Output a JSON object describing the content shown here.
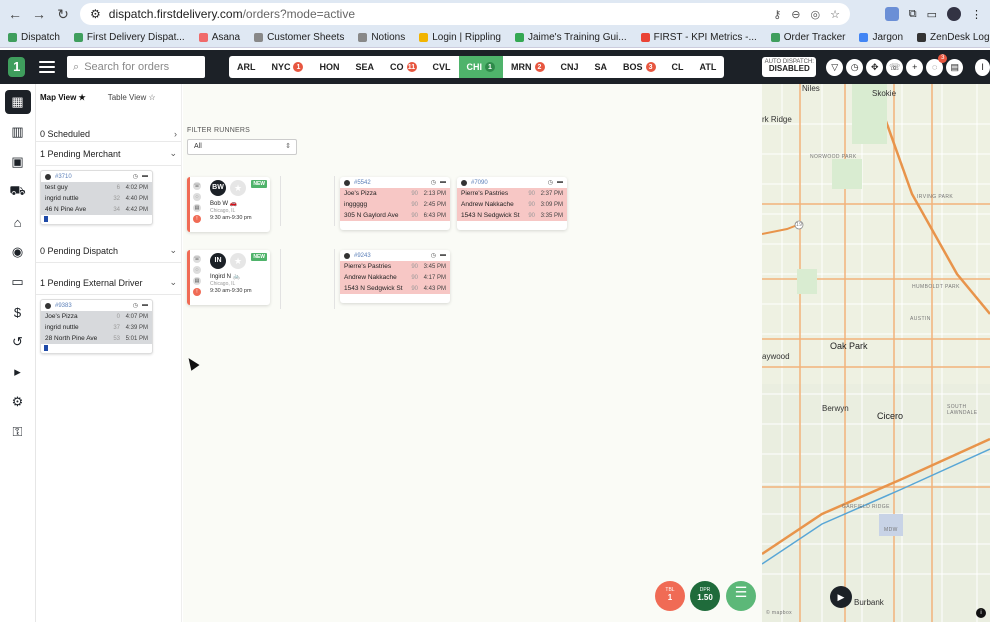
{
  "browser": {
    "url_host": "dispatch.firstdelivery.com",
    "url_path": "/orders?mode=active",
    "bookmarks": [
      {
        "label": "Dispatch",
        "color": "#3f9e5d"
      },
      {
        "label": "First Delivery Dispat...",
        "color": "#3f9e5d"
      },
      {
        "label": "Asana",
        "color": "#f06a6a"
      },
      {
        "label": "Customer Sheets",
        "color": "#888888"
      },
      {
        "label": "Notions",
        "color": "#888888"
      },
      {
        "label": "Login | Rippling",
        "color": "#f2b400"
      },
      {
        "label": "Jaime's Training Gui...",
        "color": "#34a853"
      },
      {
        "label": "FIRST - KPI Metrics -...",
        "color": "#ea4335"
      },
      {
        "label": "Order Tracker",
        "color": "#3f9e5d"
      },
      {
        "label": "Jargon",
        "color": "#4285f4"
      },
      {
        "label": "ZenDesk Login",
        "color": "#333333"
      },
      {
        "label": "onepass",
        "color": "#4285f4"
      },
      {
        "label": "Pages ‹ First Deliver...",
        "color": "#21759b"
      }
    ]
  },
  "header": {
    "search_placeholder": "Search for orders",
    "markets": [
      {
        "code": "ARL",
        "badge": "",
        "active": false
      },
      {
        "code": "NYC",
        "badge": "1",
        "active": false
      },
      {
        "code": "HON",
        "badge": "",
        "active": false
      },
      {
        "code": "SEA",
        "badge": "",
        "active": false
      },
      {
        "code": "CO",
        "badge": "11",
        "active": false
      },
      {
        "code": "CVL",
        "badge": "",
        "active": false
      },
      {
        "code": "CHI",
        "badge": "1",
        "active": true
      },
      {
        "code": "MRN",
        "badge": "2",
        "active": false
      },
      {
        "code": "CNJ",
        "badge": "",
        "active": false
      },
      {
        "code": "SA",
        "badge": "",
        "active": false
      },
      {
        "code": "BOS",
        "badge": "3",
        "active": false
      },
      {
        "code": "CL",
        "badge": "",
        "active": false
      },
      {
        "code": "ATL",
        "badge": "",
        "active": false
      }
    ],
    "auto_dispatch_title": "AUTO DISPATCH:",
    "auto_dispatch_state": "DISABLED",
    "notification_count": "3",
    "user_initial": "I"
  },
  "panel": {
    "tab_map": "Map View ★",
    "tab_table": "Table View ☆",
    "scheduled": "0 Scheduled",
    "pending_merchant": "1 Pending Merchant",
    "pending_dispatch": "0 Pending Dispatch",
    "pending_external": "1 Pending External Driver",
    "merchant_card": {
      "id": "#3710",
      "rows": [
        {
          "name": "test guy",
          "n": "6",
          "time": "4:02 PM"
        },
        {
          "name": "ingrid nuttle",
          "n": "32",
          "time": "4:40 PM"
        },
        {
          "name": "46 N Pine Ave",
          "n": "34",
          "time": "4:42 PM"
        }
      ]
    },
    "external_card": {
      "id": "#9383",
      "rows": [
        {
          "name": "Joe's Pizza",
          "n": "0",
          "time": "4:07 PM"
        },
        {
          "name": "ingrid nuttle",
          "n": "37",
          "time": "4:39 PM"
        },
        {
          "name": "28 North Pine Ave",
          "n": "53",
          "time": "5:01 PM"
        }
      ]
    }
  },
  "board": {
    "filter_label": "FILTER RUNNERS",
    "filter_value": "All",
    "runners": [
      {
        "initials": "BW",
        "name": "Bob W 🚗",
        "city": "Chicago, IL",
        "hours": "9:30 am-9:30 pm",
        "tag": "NEW"
      },
      {
        "initials": "IN",
        "name": "Ingird N 🚲",
        "city": "Chicago, IL",
        "hours": "9:30 am-9:30 pm",
        "tag": "NEW"
      }
    ],
    "orders": [
      {
        "id": "#5542",
        "rows": [
          {
            "name": "Joe's Pizza",
            "n": "90",
            "time": "2:13 PM"
          },
          {
            "name": "inggggg",
            "n": "90",
            "time": "2:45 PM"
          },
          {
            "name": "305 N Gaylord Ave",
            "n": "90",
            "time": "6:43 PM"
          }
        ]
      },
      {
        "id": "#7090",
        "rows": [
          {
            "name": "Pierre's Pastries",
            "n": "90",
            "time": "2:37 PM"
          },
          {
            "name": "Andrew Nakkache",
            "n": "90",
            "time": "3:09 PM"
          },
          {
            "name": "1543 N Sedgwick St",
            "n": "90",
            "time": "3:35 PM"
          }
        ]
      },
      {
        "id": "#9243",
        "rows": [
          {
            "name": "Pierre's Pastries",
            "n": "90",
            "time": "3:45 PM"
          },
          {
            "name": "Andrew Nakkache",
            "n": "90",
            "time": "4:17 PM"
          },
          {
            "name": "1543 N Sedgwick St",
            "n": "90",
            "time": "4:43 PM"
          }
        ]
      }
    ],
    "stats": [
      {
        "label": "TBL",
        "value": "1",
        "color": "#f06b55"
      },
      {
        "label": "DPR",
        "value": "1.50",
        "color": "#1f6b3b"
      }
    ]
  },
  "map": {
    "labels": {
      "niles": "Niles",
      "skokie": "Skokie",
      "park_ridge": "rk Ridge",
      "norwood": "NORWOOD PARK",
      "irving": "IRVING PARK",
      "humboldt": "HUMBOLDT PARK",
      "austin": "AUSTIN",
      "oak_park": "Oak Park",
      "aywood": "aywood",
      "berwyn": "Berwyn",
      "cicero": "Cicero",
      "south_lawndale": "SOUTH LAWNDALE",
      "garfield": "GARFIELD RIDGE",
      "mdw": "MDW",
      "burbank": "Burbank",
      "route_19": "19",
      "mapbox": "© mapbox"
    }
  }
}
